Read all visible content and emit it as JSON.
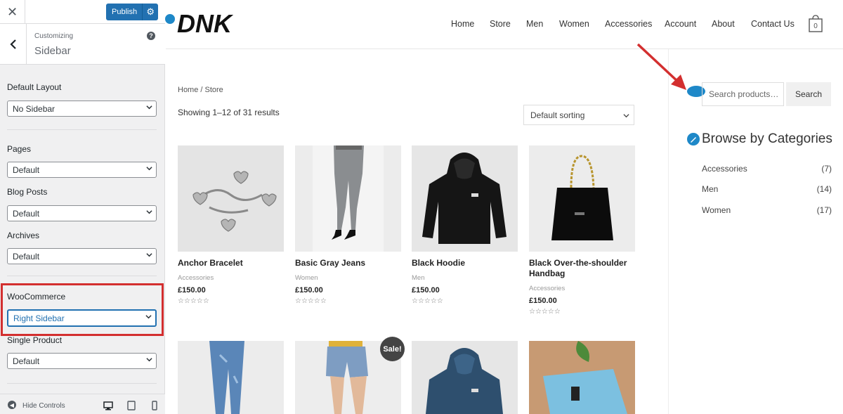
{
  "customizer": {
    "close_icon": "close-icon",
    "publish_label": "Publish",
    "section_sub": "Customizing",
    "section_title": "Sidebar",
    "fields": [
      {
        "label": "Default Layout",
        "value": "No Sidebar"
      },
      {
        "label": "Pages",
        "value": "Default"
      },
      {
        "label": "Blog Posts",
        "value": "Default"
      },
      {
        "label": "Archives",
        "value": "Default"
      },
      {
        "label": "WooCommerce",
        "value": "Right Sidebar"
      },
      {
        "label": "Single Product",
        "value": "Default"
      }
    ],
    "hide_controls_label": "Hide Controls"
  },
  "site": {
    "logo_text": "DNK",
    "nav": [
      "Home",
      "Store",
      "Men",
      "Women",
      "Accessories",
      "Account",
      "About",
      "Contact Us"
    ],
    "cart_count": "0",
    "breadcrumb": "Home / Store",
    "result_count": "Showing 1–12 of 31 results",
    "sorting": "Default sorting",
    "products": [
      {
        "name": "Anchor Bracelet",
        "category": "Accessories",
        "price": "£150.00",
        "stars": "☆☆☆☆☆"
      },
      {
        "name": "Basic Gray Jeans",
        "category": "Women",
        "price": "£150.00",
        "stars": "☆☆☆☆☆"
      },
      {
        "name": "Black Hoodie",
        "category": "Men",
        "price": "£150.00",
        "stars": "☆☆☆☆☆"
      },
      {
        "name": "Black Over-the-shoulder Handbag",
        "category": "Accessories",
        "price": "£150.00",
        "stars": "☆☆☆☆☆"
      }
    ],
    "sale_badge": "Sale!",
    "sidebar": {
      "search_placeholder": "Search products…",
      "search_button": "Search",
      "categories_title": "Browse by Categories",
      "categories": [
        {
          "name": "Accessories",
          "count": "(7)"
        },
        {
          "name": "Men",
          "count": "(14)"
        },
        {
          "name": "Women",
          "count": "(17)"
        }
      ]
    }
  },
  "colors": {
    "publish_blue": "#2271b1",
    "edit_shortcut_blue": "#1e88c8",
    "highlight_red": "#d32f2f"
  }
}
